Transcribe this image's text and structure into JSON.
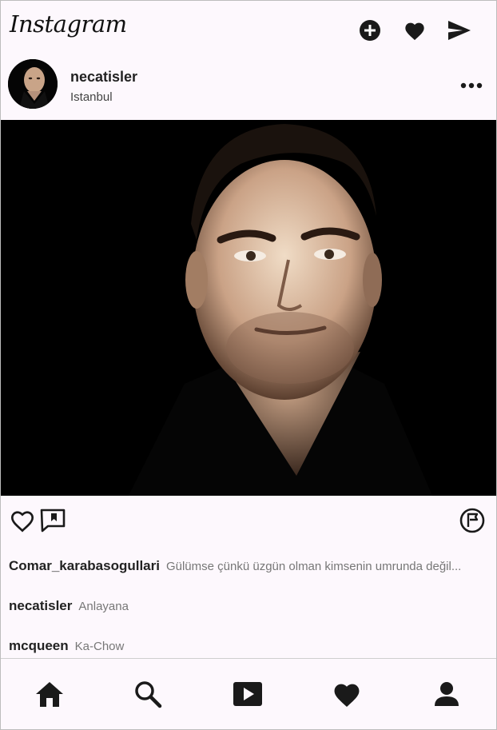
{
  "app": {
    "logo_text": "Instagram"
  },
  "top_bar": {
    "icons": [
      "add-post-icon",
      "heart-icon",
      "send-icon"
    ]
  },
  "post": {
    "username": "necatisler",
    "location": "Istanbul",
    "image_description_icon": "profile-photo"
  },
  "actions": {
    "icons": [
      "like-icon",
      "comment-icon",
      "save-icon"
    ]
  },
  "comments": [
    {
      "user": "Comar_karabasogullari",
      "text": "Gülümse çünkü üzgün olman kimsenin umrunda değil..."
    },
    {
      "user": "necatisler",
      "text": "Anlayana"
    },
    {
      "user": "mcqueen",
      "text": "Ka-Chow"
    }
  ],
  "bottom_nav": {
    "items": [
      "home-icon",
      "search-icon",
      "reels-icon",
      "activity-icon",
      "profile-icon"
    ]
  },
  "colors": {
    "background": "#fdf8fd",
    "icon": "#1a1a1a",
    "secondary_text": "#777777"
  }
}
